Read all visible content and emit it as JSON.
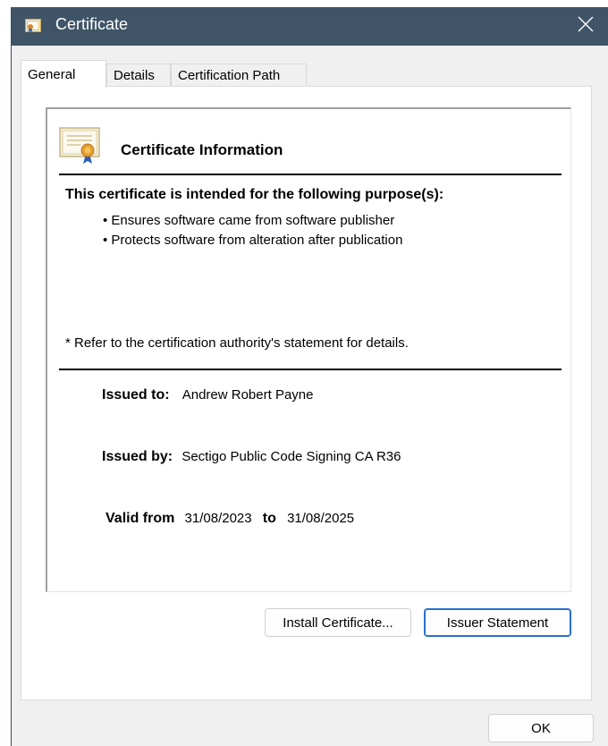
{
  "window": {
    "title": "Certificate"
  },
  "tabs": [
    {
      "label": "General",
      "active": true
    },
    {
      "label": "Details",
      "active": false
    },
    {
      "label": "Certification Path",
      "active": false
    }
  ],
  "certificate": {
    "heading": "Certificate Information",
    "purpose_heading": "This certificate is intended for the following purpose(s):",
    "purposes": [
      "Ensures software came from software publisher",
      "Protects software from alteration after publication"
    ],
    "note": "* Refer to the certification authority's statement for details.",
    "issued_to_label": "Issued to:",
    "issued_to": "Andrew Robert Payne",
    "issued_by_label": "Issued by:",
    "issued_by": "Sectigo Public Code Signing CA R36",
    "valid_from_label": "Valid from",
    "valid_from": "31/08/2023",
    "valid_to_label": "to",
    "valid_to": "31/08/2025"
  },
  "buttons": {
    "install": "Install Certificate...",
    "issuer_statement": "Issuer Statement",
    "ok": "OK"
  },
  "colors": {
    "titlebar": "#3f5467",
    "dialog_bg": "#f0f0f0",
    "focus_border": "#2a6ecf"
  },
  "icons": {
    "title": "certificate-icon",
    "close": "close-icon",
    "info": "certificate-ribbon-icon"
  }
}
